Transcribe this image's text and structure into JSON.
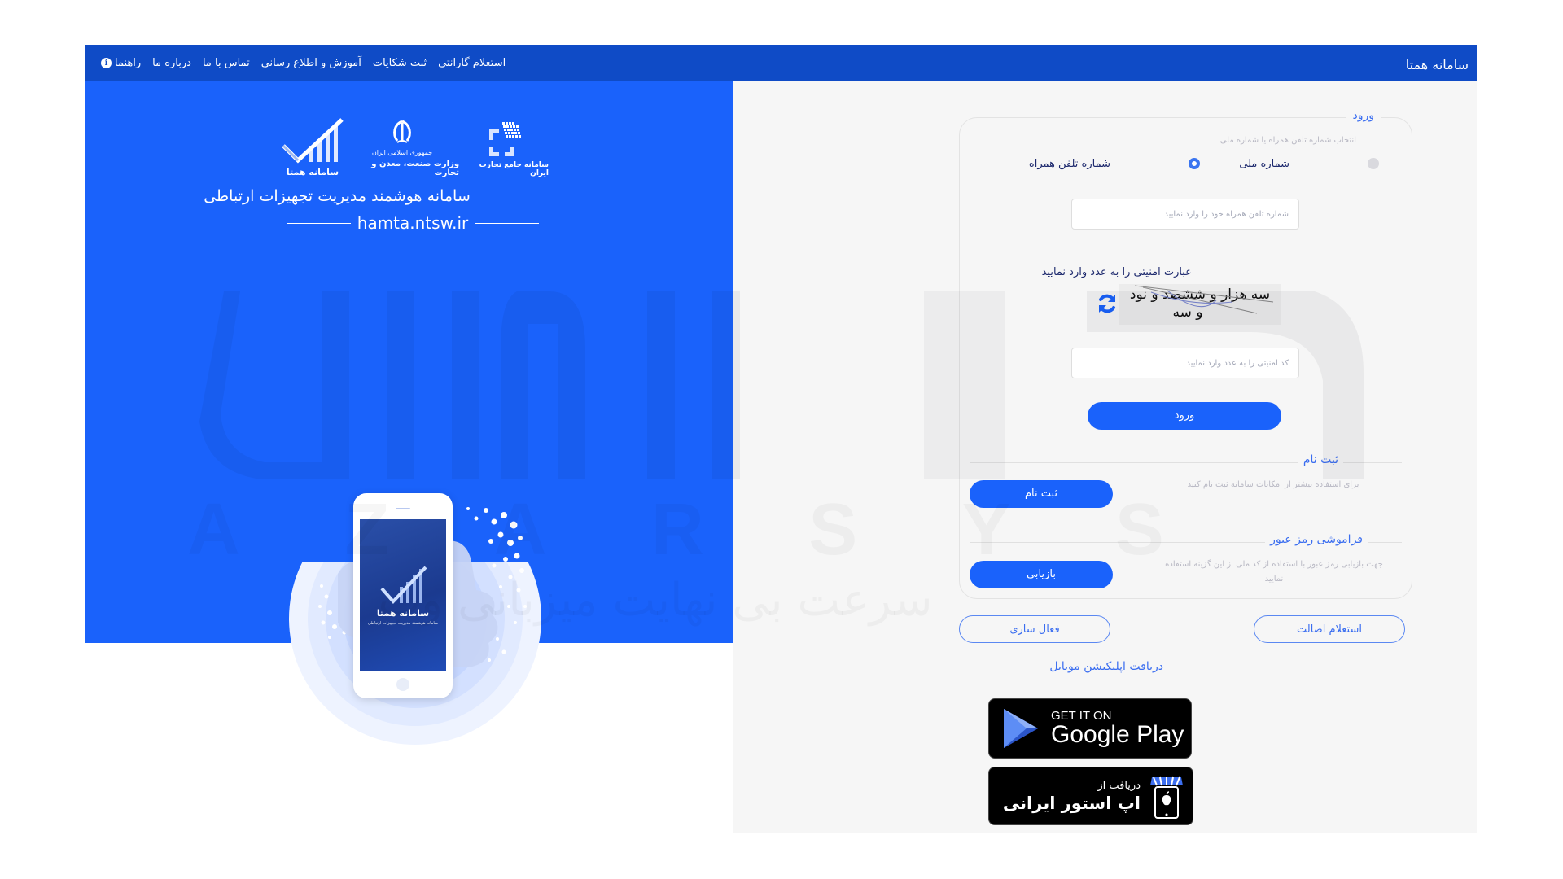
{
  "header": {
    "brand": "سامانه همتا",
    "nav": [
      {
        "label": "استعلام گارانتی"
      },
      {
        "label": "ثبت شکایات"
      },
      {
        "label": "آموزش و اطلاع رسانی"
      },
      {
        "label": "تماس با ما"
      },
      {
        "label": "درباره ما"
      },
      {
        "label": "راهنما",
        "icon": "info-icon"
      }
    ]
  },
  "hero": {
    "logos": [
      {
        "name": "iran-trade-system",
        "caption": "سامانه جامع تجارت ایران"
      },
      {
        "name": "ministry",
        "caption_top": "جمهوری اسلامی ایران",
        "caption": "وزارت صنعت، معدن و تجارت"
      },
      {
        "name": "hamta",
        "caption": "سامانه همتا"
      }
    ],
    "title": "سامانه هوشمند مدیریت تجهیزات ارتباطی",
    "url": "hamta.ntsw.ir",
    "phone": {
      "brand": "سامانه همتا",
      "subtitle": "سامانه هوشمند مدیریت تجهیزات ارتباطی"
    }
  },
  "login": {
    "legend": "ورود",
    "hint": "انتخاب شماره تلفن همراه یا شماره ملی",
    "options": [
      {
        "label": "شماره ملی",
        "selected": false
      },
      {
        "label": "شماره تلفن همراه",
        "selected": true
      }
    ],
    "phone_placeholder": "شماره تلفن همراه خود را وارد نمایید",
    "captcha_label": "عبارت امنیتی را به عدد وارد نمایید",
    "captcha_text_line1": "سه هزار و ششصد و نود",
    "captcha_text_line2": "و سه",
    "captcha_placeholder": "کد امنیتی را به عدد وارد نمایید",
    "submit_label": "ورود"
  },
  "register": {
    "title": "ثبت نام",
    "description": "برای استفاده بیشتر از امکانات سامانه ثبت نام کنید",
    "button_label": "ثبت نام"
  },
  "recovery": {
    "title": "فراموشی رمز عبور",
    "description": "جهت بازیابی رمز عبور با استفاده از کد ملی از این گزینه استفاده نمایید",
    "button_label": "بازیابی"
  },
  "actions": {
    "authenticity_label": "استعلام اصالت",
    "activation_label": "فعال سازی"
  },
  "apps": {
    "title": "دریافت اپلیکیشن موبایل",
    "google_play_small": "GET IT ON",
    "google_play_big": "Google Play",
    "iranapps_small": "دریافت از",
    "iranapps_big": "اپ استور ایرانی"
  },
  "watermark": {
    "latin": [
      "A",
      "Z",
      "A",
      "R",
      "S",
      "Y",
      "S"
    ],
    "persian": "سرعت بی نهایت میزبانی وب"
  },
  "colors": {
    "header": "#0f4bc6",
    "primary": "#1a62fb",
    "accent_text": "#3b6ef0",
    "panel_bg": "#f6f6f6"
  }
}
